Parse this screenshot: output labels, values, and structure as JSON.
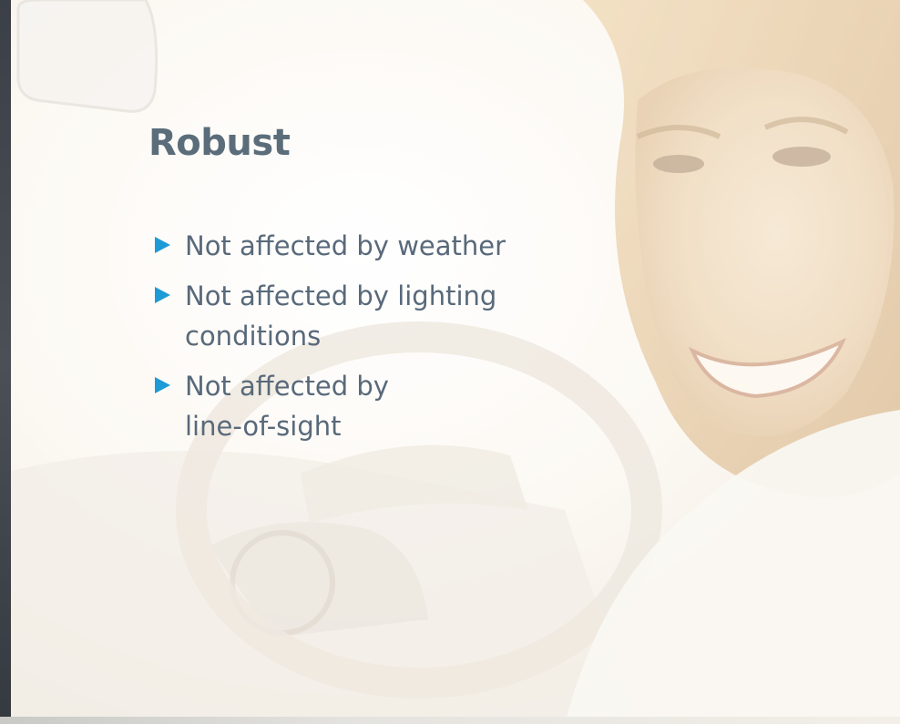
{
  "slide": {
    "title": "Robust",
    "bullets": [
      "Not affected by weather",
      "Not affected by lighting conditions",
      "Not affected by line-of-sight"
    ]
  },
  "background": {
    "description_icon": "photo-woman-driving-car",
    "colors": {
      "accent": "#1d9bd6",
      "text": "#58697a",
      "title": "#5b6d7a",
      "strip": "#3b4046"
    }
  }
}
